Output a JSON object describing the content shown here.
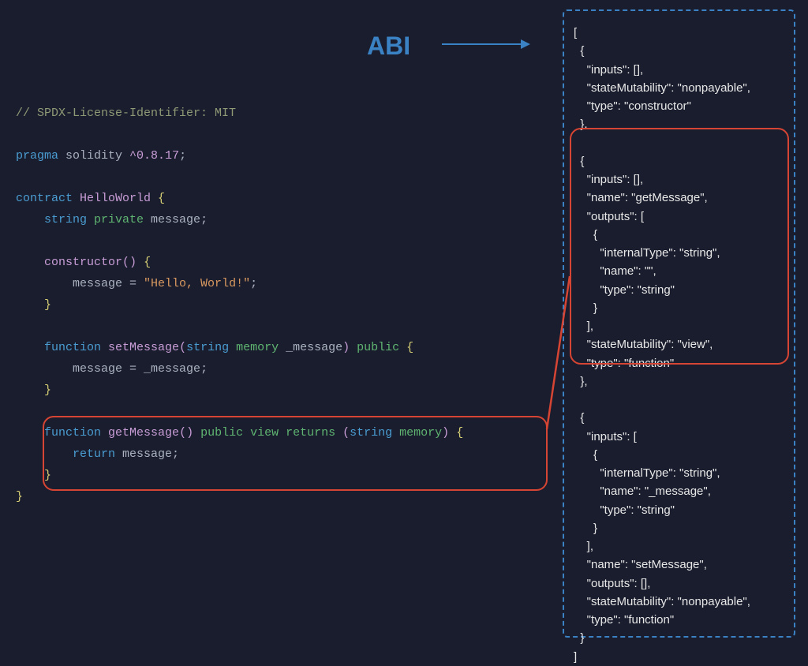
{
  "abi_label": "ABI",
  "code": {
    "l1_comment": "// SPDX-License-Identifier: MIT",
    "l2_pragma": "pragma",
    "l2_solidity": " solidity ",
    "l2_caret": "^",
    "l2_version": "0.8.17",
    "l2_semi": ";",
    "l3_contract": "contract",
    "l3_name": " HelloWorld ",
    "l3_brace": "{",
    "l4_indent": "    ",
    "l4_string": "string",
    "l4_private": " private ",
    "l4_var": "message",
    "l4_semi": ";",
    "l5_indent": "    ",
    "l5_constructor": "constructor",
    "l5_paren": "() ",
    "l5_brace": "{",
    "l6_indent": "        ",
    "l6_msg": "message ",
    "l6_eq": "= ",
    "l6_str": "\"Hello, World!\"",
    "l6_semi": ";",
    "l7_indent": "    ",
    "l7_brace": "}",
    "l8_indent": "    ",
    "l8_function": "function",
    "l8_name": " setMessage",
    "l8_po": "(",
    "l8_string": "string",
    "l8_memory": " memory ",
    "l8_param": "_message",
    "l8_pc": ") ",
    "l8_public": "public ",
    "l8_brace": "{",
    "l9_indent": "        ",
    "l9_msg": "message ",
    "l9_eq": "= ",
    "l9_param": "_message",
    "l9_semi": ";",
    "l10_indent": "    ",
    "l10_brace": "}",
    "l11_indent": "    ",
    "l11_function": "function",
    "l11_name": " getMessage",
    "l11_paren": "() ",
    "l11_public": "public ",
    "l11_view": "view ",
    "l11_returns": "returns ",
    "l11_po": "(",
    "l11_string": "string",
    "l11_memory": " memory",
    "l11_pc": ") ",
    "l11_brace": "{",
    "l12_indent": "        ",
    "l12_return": "return ",
    "l12_msg": "message",
    "l12_semi": ";",
    "l13_indent": "    ",
    "l13_brace": "}",
    "l14_brace": "}"
  },
  "abi": {
    "a01": "[",
    "a02": "  {",
    "a03": "    \"inputs\": [],",
    "a04": "    \"stateMutability\": \"nonpayable\",",
    "a05": "    \"type\": \"constructor\"",
    "a06": "  },",
    "a07": "",
    "a08": "  {",
    "a09": "    \"inputs\": [],",
    "a10": "    \"name\": \"getMessage\",",
    "a11": "    \"outputs\": [",
    "a12": "      {",
    "a13": "        \"internalType\": \"string\",",
    "a14": "        \"name\": \"\",",
    "a15": "        \"type\": \"string\"",
    "a16": "      }",
    "a17": "    ],",
    "a18": "    \"stateMutability\": \"view\",",
    "a19": "    \"type\": \"function\"",
    "a20": "  },",
    "a21": "",
    "a22": "  {",
    "a23": "    \"inputs\": [",
    "a24": "      {",
    "a25": "        \"internalType\": \"string\",",
    "a26": "        \"name\": \"_message\",",
    "a27": "        \"type\": \"string\"",
    "a28": "      }",
    "a29": "    ],",
    "a30": "    \"name\": \"setMessage\",",
    "a31": "    \"outputs\": [],",
    "a32": "    \"stateMutability\": \"nonpayable\",",
    "a33": "    \"type\": \"function\"",
    "a34": "  }",
    "a35": "]"
  }
}
